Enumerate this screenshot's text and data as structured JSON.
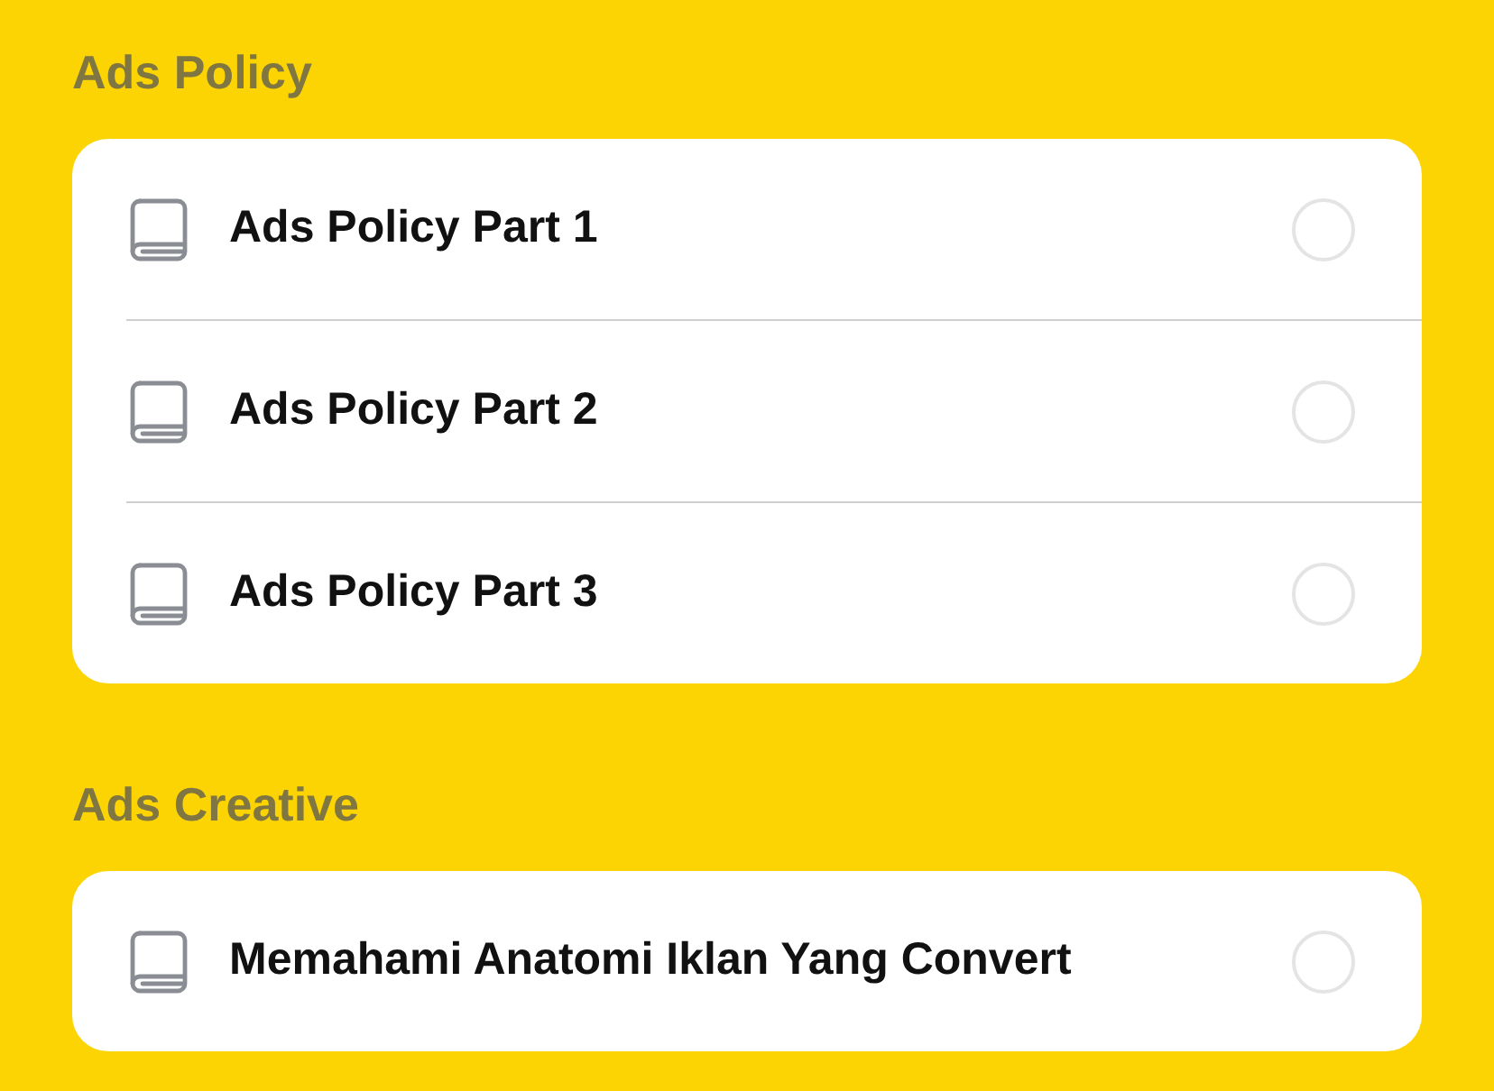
{
  "sections": [
    {
      "title": "Ads Policy",
      "lessons": [
        {
          "title": "Ads Policy Part 1",
          "checked": false
        },
        {
          "title": "Ads Policy Part 2",
          "checked": false
        },
        {
          "title": "Ads Policy Part 3",
          "checked": false
        }
      ]
    },
    {
      "title": "Ads Creative",
      "lessons": [
        {
          "title": "Memahami Anatomi Iklan Yang Convert",
          "checked": false
        }
      ]
    }
  ]
}
